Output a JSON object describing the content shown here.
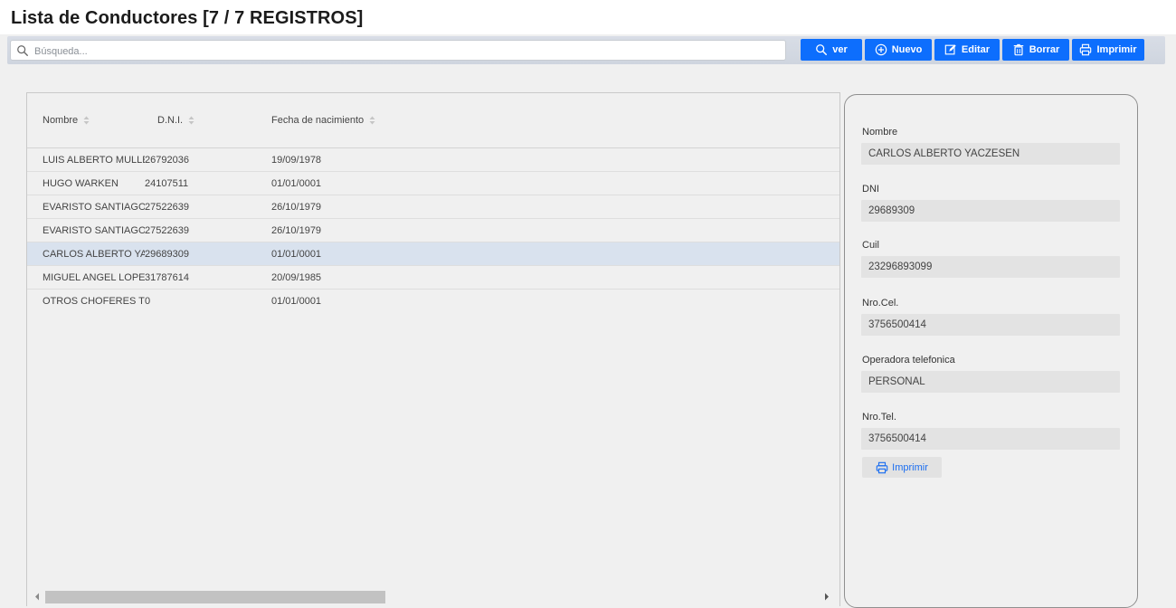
{
  "header": {
    "title": "Lista de Conductores [7 / 7 REGISTROS]"
  },
  "search": {
    "placeholder": "Búsqueda..."
  },
  "toolbar": {
    "ver_label": "ver",
    "nuevo_label": "Nuevo",
    "editar_label": "Editar",
    "borrar_label": "Borrar",
    "imprimir_label": "Imprimir"
  },
  "table": {
    "columns": [
      "Nombre",
      "D.N.I.",
      "Fecha de nacimiento"
    ],
    "rows": [
      {
        "nombre": "LUIS ALBERTO MULLER",
        "dni": "26792036",
        "fecha": "19/09/1978"
      },
      {
        "nombre": "HUGO WARKEN",
        "dni": "24107511",
        "fecha": "01/01/0001"
      },
      {
        "nombre": "EVARISTO SANTIAGO",
        "dni": "27522639",
        "fecha": "26/10/1979"
      },
      {
        "nombre": "EVARISTO SANTIAGO",
        "dni": "27522639",
        "fecha": "26/10/1979"
      },
      {
        "nombre": "CARLOS ALBERTO YACZESEN",
        "dni": "29689309",
        "fecha": "01/01/0001"
      },
      {
        "nombre": "MIGUEL ANGEL LOPEZ",
        "dni": "31787614",
        "fecha": "20/09/1985"
      },
      {
        "nombre": "OTROS CHOFERES TERCEROS",
        "dni": "0",
        "fecha": "01/01/0001"
      }
    ],
    "selected_row": 4
  },
  "detail": {
    "fields": [
      {
        "label": "Nombre",
        "value": "CARLOS ALBERTO YACZESEN"
      },
      {
        "label": "DNI",
        "value": "29689309"
      },
      {
        "label": "Cuil",
        "value": "23296893099"
      },
      {
        "label": "Nro.Cel.",
        "value": "3756500414"
      },
      {
        "label": "Operadora telefonica",
        "value": "PERSONAL"
      },
      {
        "label": "Nro.Tel.",
        "value": "3756500414"
      }
    ],
    "print_label": "Imprimir"
  },
  "icons": {
    "search": "search-icon",
    "add": "plus-circle-icon",
    "edit": "edit-icon",
    "delete": "trash-icon",
    "print": "printer-icon",
    "sort": "sort-icon"
  },
  "colors": {
    "primary": "#0d6efd",
    "selected_row": "#d9e2ee",
    "toolbar_bg": "#d3d9e2",
    "print_link": "#1a6df0"
  }
}
